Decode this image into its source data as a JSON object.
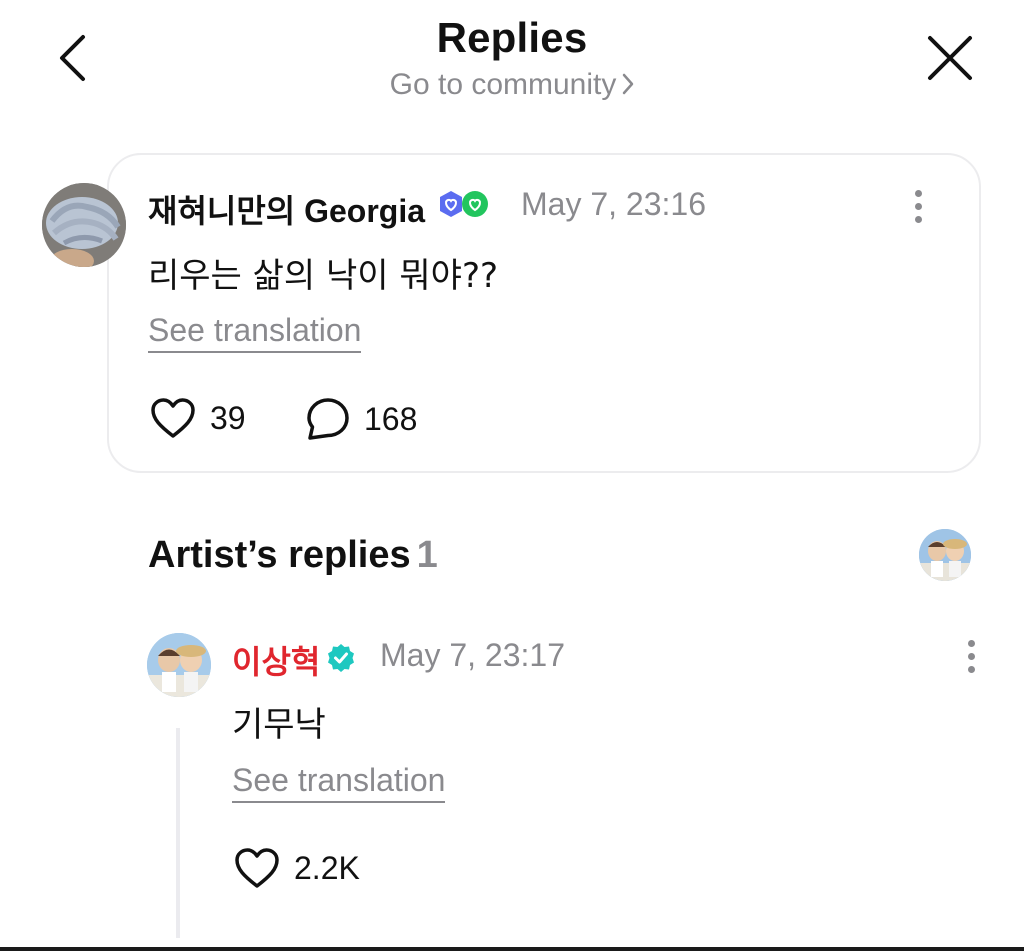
{
  "header": {
    "title": "Replies",
    "community_link": "Go to community",
    "back_icon": "chevron-left-icon",
    "close_icon": "close-icon"
  },
  "post": {
    "author": "재혀니만의 Georgia",
    "timestamp": "May 7, 23:16",
    "text": "리우는 삶의 낙이 뭐야??",
    "see_translation": "See translation",
    "likes": "39",
    "comments": "168",
    "badge_colors": [
      "#5b6cf0",
      "#22c55e"
    ]
  },
  "artist_replies": {
    "title": "Artist’s replies",
    "count": "1",
    "reply": {
      "author": "이상혁",
      "author_color": "#e0262e",
      "verified_color": "#1ec8c0",
      "timestamp": "May 7, 23:17",
      "text": "기무낙",
      "see_translation": "See translation",
      "likes": "2.2K"
    }
  }
}
